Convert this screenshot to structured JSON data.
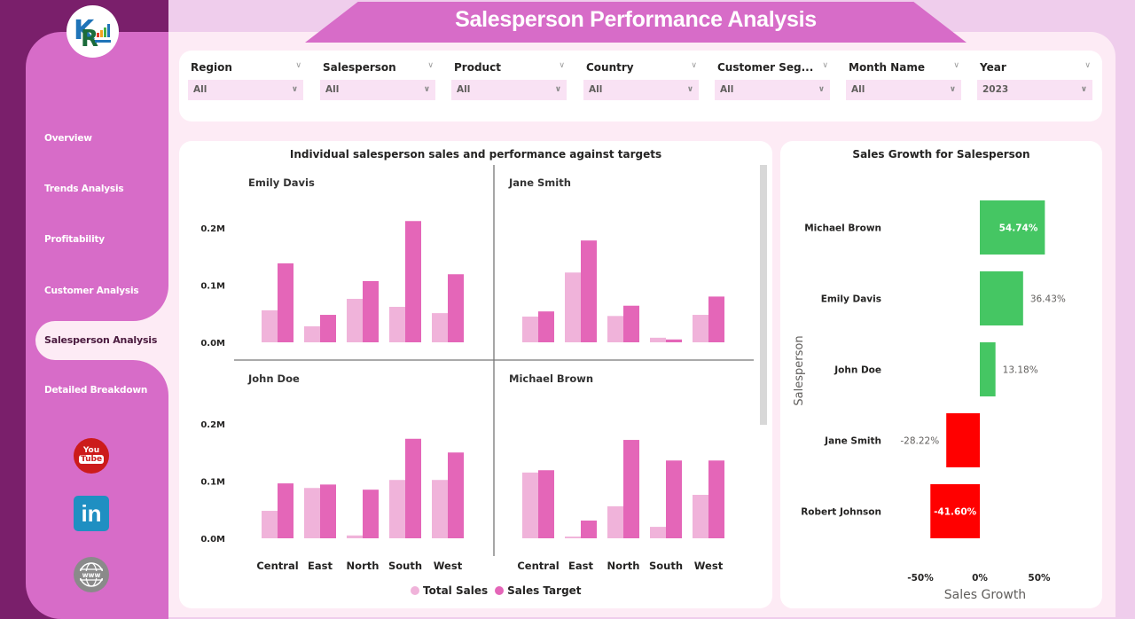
{
  "app": {
    "title": "Salesperson Performance Analysis"
  },
  "sidebar": {
    "logo": "logo-icon",
    "items": [
      {
        "label": "Overview",
        "active": false
      },
      {
        "label": "Trends Analysis",
        "active": false
      },
      {
        "label": "Profitability",
        "active": false
      },
      {
        "label": "Customer Analysis",
        "active": false
      },
      {
        "label": "Salesperson Analysis",
        "active": true
      },
      {
        "label": "Detailed Breakdown",
        "active": false
      }
    ],
    "social": [
      {
        "name": "youtube-icon",
        "label_top": "You",
        "label_bottom": "Tube"
      },
      {
        "name": "linkedin-icon",
        "label": "in"
      },
      {
        "name": "website-icon",
        "label": "www"
      }
    ]
  },
  "filters": [
    {
      "label": "Region",
      "value": "All"
    },
    {
      "label": "Salesperson",
      "value": "All"
    },
    {
      "label": "Product",
      "value": "All"
    },
    {
      "label": "Country",
      "value": "All"
    },
    {
      "label": "Customer Seg...",
      "value": "All"
    },
    {
      "label": "Month Name",
      "value": "All"
    },
    {
      "label": "Year",
      "value": "2023"
    }
  ],
  "colors": {
    "total_sales": "#f0b3da",
    "sales_target": "#e466b8",
    "positive": "#45c663",
    "negative": "#ff0000",
    "accent": "#d76cc8",
    "dark": "#7a1f6b"
  },
  "legend": {
    "total_sales": "Total Sales",
    "sales_target": "Sales Target"
  },
  "chart_data": [
    {
      "type": "bar",
      "title": "Individual salesperson sales and performance against targets",
      "xlabel": "",
      "ylabel": "",
      "ylim": [
        0,
        0.2
      ],
      "yticks": [
        "0.0M",
        "0.1M",
        "0.2M"
      ],
      "ytick_values": [
        0,
        0.1,
        0.2
      ],
      "categories": [
        "Central",
        "East",
        "North",
        "South",
        "West"
      ],
      "legend": [
        "Total Sales",
        "Sales Target"
      ],
      "legend_position": "bottom",
      "units": "M",
      "panels": [
        {
          "name": "Emily Davis",
          "series": [
            {
              "name": "Total Sales",
              "values": [
                0.056,
                0.028,
                0.076,
                0.062,
                0.051
              ]
            },
            {
              "name": "Sales Target",
              "values": [
                0.138,
                0.048,
                0.107,
                0.212,
                0.119
              ]
            }
          ]
        },
        {
          "name": "Jane Smith",
          "series": [
            {
              "name": "Total Sales",
              "values": [
                0.045,
                0.122,
                0.046,
                0.008,
                0.048
              ]
            },
            {
              "name": "Sales Target",
              "values": [
                0.054,
                0.178,
                0.064,
                0.005,
                0.08
              ]
            }
          ]
        },
        {
          "name": "John Doe",
          "series": [
            {
              "name": "Total Sales",
              "values": [
                0.048,
                0.088,
                0.005,
                0.102,
                0.102
              ]
            },
            {
              "name": "Sales Target",
              "values": [
                0.096,
                0.094,
                0.085,
                0.174,
                0.15
              ]
            }
          ]
        },
        {
          "name": "Michael Brown",
          "series": [
            {
              "name": "Total Sales",
              "values": [
                0.115,
                0.003,
                0.056,
                0.02,
                0.076
              ]
            },
            {
              "name": "Sales Target",
              "values": [
                0.119,
                0.031,
                0.172,
                0.136,
                0.136
              ]
            }
          ]
        }
      ]
    },
    {
      "type": "bar",
      "orientation": "horizontal",
      "title": "Sales Growth for Salesperson",
      "xlabel": "Sales Growth",
      "ylabel": "Salesperson",
      "xlim": [
        -0.5,
        0.5
      ],
      "xticks": [
        "-50%",
        "0%",
        "50%"
      ],
      "xtick_values": [
        -0.5,
        0,
        0.5
      ],
      "categories": [
        "Michael Brown",
        "Emily Davis",
        "John Doe",
        "Jane Smith",
        "Robert Johnson"
      ],
      "values": [
        0.5474,
        0.3643,
        0.1318,
        -0.2822,
        -0.416
      ],
      "labels": [
        "54.74%",
        "36.43%",
        "13.18%",
        "-28.22%",
        "-41.60%"
      ],
      "grid": false
    }
  ]
}
